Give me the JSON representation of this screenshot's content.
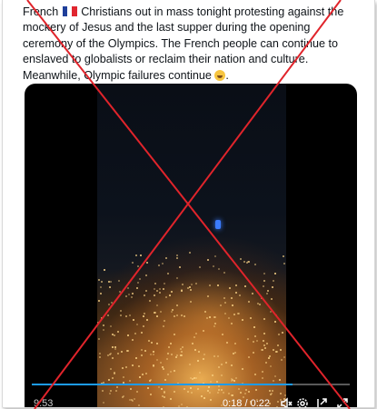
{
  "tweet": {
    "text_part1": "French ",
    "flag_icon": "france-flag-icon",
    "text_part2": " Christians out in mass tonight protesting against the mockery of Jesus and the last supper during the opening ceremony of the Olympics. The French people can continue to enslaved to globalists or reclaim their nation and culture. Meanwhile, Olympic failures continue ",
    "emoji_icon": "laughing-face-icon",
    "text_part3": "."
  },
  "video": {
    "views": "9.53",
    "time": "0:18 / 0:22",
    "progress": 0.82,
    "icons": [
      "mute-icon",
      "settings-icon",
      "pip-icon",
      "fullscreen-icon"
    ]
  },
  "overlay": {
    "color": "#e0242b",
    "type": "red-x-cross-out"
  }
}
